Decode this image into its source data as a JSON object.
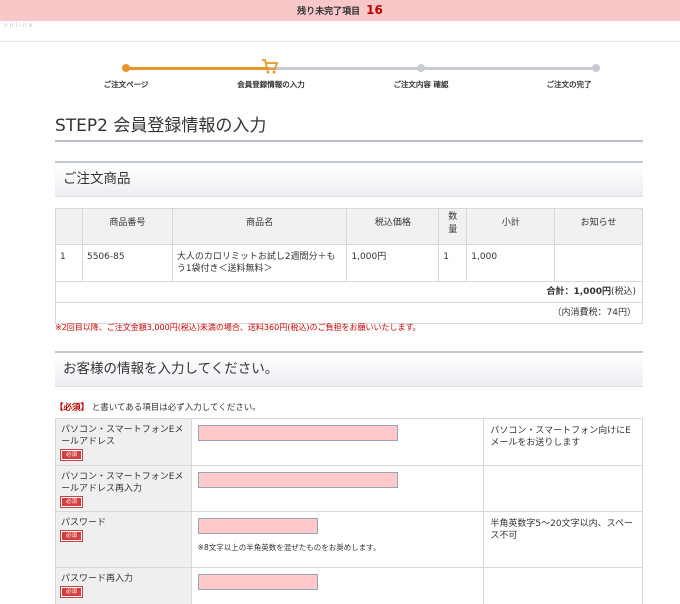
{
  "banner": {
    "label": "残り未完了項目",
    "count": "16"
  },
  "brand": "online",
  "steps": [
    {
      "label": "ご注文ページ"
    },
    {
      "label": "会員登録情報の入力"
    },
    {
      "label": "ご注文内容 確認"
    },
    {
      "label": "ご注文の完了"
    }
  ],
  "page_title": "STEP2 会員登録情報の入力",
  "order_section": {
    "title": "ご注文商品",
    "columns": [
      "",
      "商品番号",
      "商品名",
      "税込価格",
      "数量",
      "小計",
      "お知らせ"
    ],
    "rows": [
      {
        "no": "1",
        "code": "5506-85",
        "name": "大人のカロリミットお試し2週間分＋もう1袋付き＜送料無料＞",
        "price": "1,000円",
        "qty": "1",
        "subtotal": "1,000",
        "info": ""
      }
    ],
    "total_label": "合計：",
    "total_value": "1,000円",
    "total_suffix": "(税込)",
    "tax_line": "（内消費税：74円）",
    "notice": "※2回目以降、ご注文金額3,000円(税込)未満の場合、送料360円(税込)のご負担をお願いいたします。"
  },
  "customer_section": {
    "title": "お客様の情報を入力してください。",
    "required_mark": "【必須】",
    "required_text": "と書いてある項目は必ず入力してください。",
    "badge": "必須",
    "fields": [
      {
        "label": "パソコン・スマートフォンEメールアドレス",
        "note": "パソコン・スマートフォン向けにEメールをお送りします",
        "hint": ""
      },
      {
        "label": "パソコン・スマートフォンEメールアドレス再入力",
        "note": "",
        "hint": ""
      },
      {
        "label": "パスワード",
        "note": "半角英数字5〜20文字以内、スペース不可",
        "hint": "※8文字以上の半角英数を混ぜたものをお奨めします。"
      },
      {
        "label": "パスワード再入力",
        "note": "",
        "hint": ""
      }
    ]
  }
}
